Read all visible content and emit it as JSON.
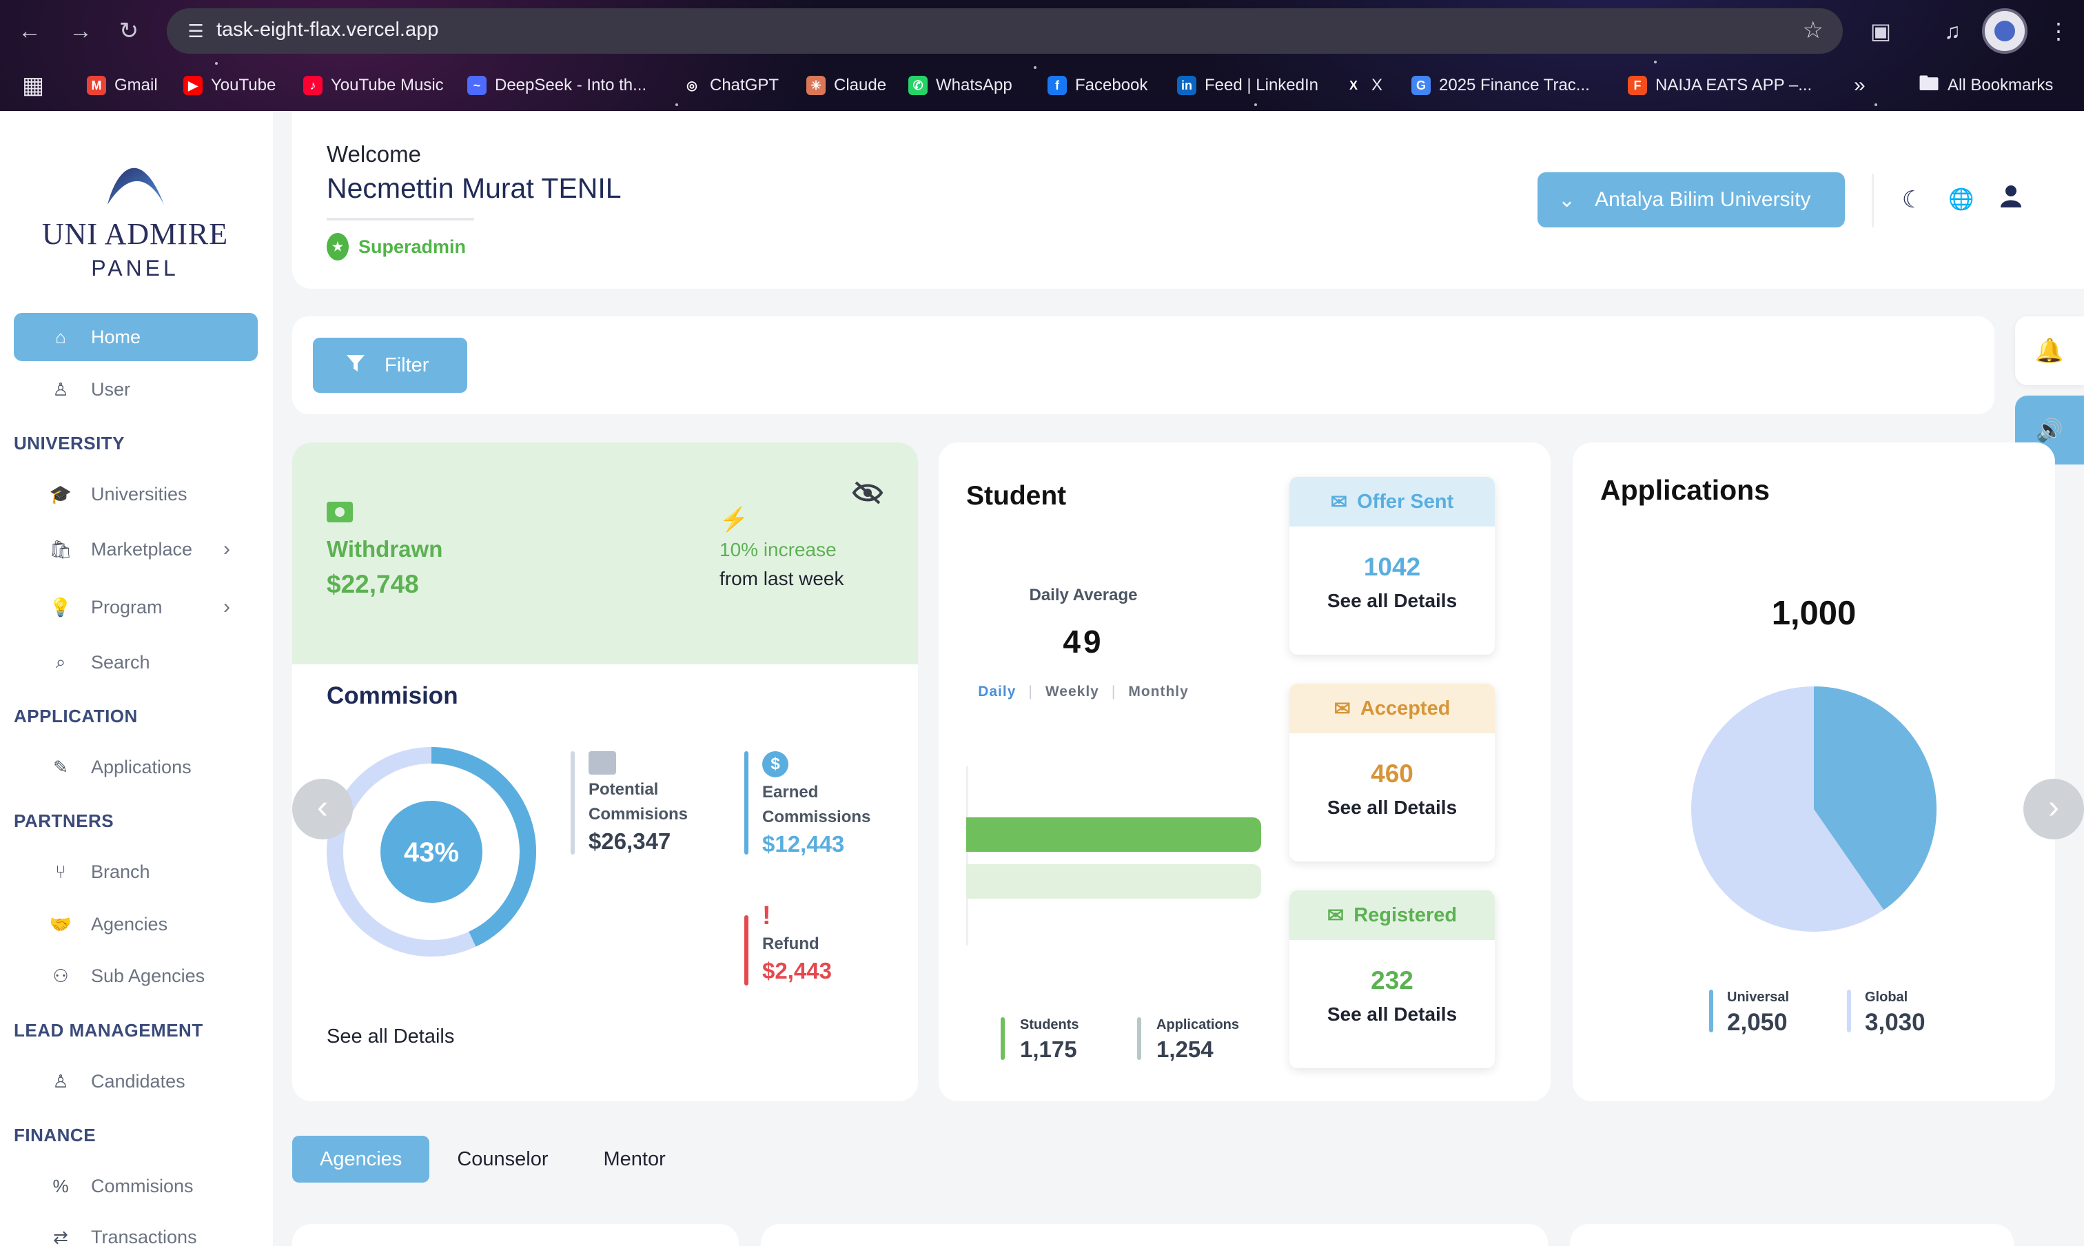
{
  "browser": {
    "url": "task-eight-flax.vercel.app",
    "bookmarks": [
      {
        "label": "Gmail",
        "icon": "gmail-icon",
        "color": "#ea4335"
      },
      {
        "label": "YouTube",
        "icon": "youtube-icon",
        "color": "#ff0000"
      },
      {
        "label": "YouTube Music",
        "icon": "youtube-music-icon",
        "color": "#ff0033"
      },
      {
        "label": "DeepSeek - Into th...",
        "icon": "deepseek-icon",
        "color": "#4d6bfe"
      },
      {
        "label": "ChatGPT",
        "icon": "chatgpt-icon",
        "color": "#ffffff"
      },
      {
        "label": "Claude",
        "icon": "claude-icon",
        "color": "#d97757"
      },
      {
        "label": "WhatsApp",
        "icon": "whatsapp-icon",
        "color": "#25d366"
      },
      {
        "label": "Facebook",
        "icon": "facebook-icon",
        "color": "#1877f2"
      },
      {
        "label": "Feed | LinkedIn",
        "icon": "linkedin-icon",
        "color": "#0a66c2"
      },
      {
        "label": "X",
        "icon": "x-icon",
        "color": "#000000"
      },
      {
        "label": "2025 Finance Trac...",
        "icon": "google-icon",
        "color": "#4285f4"
      },
      {
        "label": "NAIJA EATS APP –...",
        "icon": "figma-icon",
        "color": "#f24e1e"
      }
    ],
    "all_bookmarks": "All Bookmarks"
  },
  "sidebar": {
    "logo_title": "UNI ADMIRE",
    "logo_subtitle": "PANEL",
    "items_top": [
      {
        "label": "Home",
        "icon": "home-icon"
      },
      {
        "label": "User",
        "icon": "user-icon"
      }
    ],
    "sections": [
      {
        "title": "UNIVERSITY",
        "items": [
          {
            "label": "Universities",
            "icon": "graduation-cap-icon"
          },
          {
            "label": "Marketplace",
            "icon": "shopping-bag-icon"
          },
          {
            "label": "Program",
            "icon": "lightbulb-icon"
          },
          {
            "label": "Search",
            "icon": "search-icon"
          }
        ]
      },
      {
        "title": "APPLICATION",
        "items": [
          {
            "label": "Applications",
            "icon": "edit-document-icon"
          }
        ]
      },
      {
        "title": "PARTNERS",
        "items": [
          {
            "label": "Branch",
            "icon": "git-branch-icon"
          },
          {
            "label": "Agencies",
            "icon": "handshake-icon"
          },
          {
            "label": "Sub Agencies",
            "icon": "org-tree-icon"
          }
        ]
      },
      {
        "title": "LEAD MANAGEMENT",
        "items": [
          {
            "label": "Candidates",
            "icon": "user-icon"
          }
        ]
      },
      {
        "title": "FINANCE",
        "items": [
          {
            "label": "Commisions",
            "icon": "percent-icon"
          },
          {
            "label": "Transactions",
            "icon": "transactions-icon"
          }
        ]
      }
    ]
  },
  "header": {
    "welcome": "Welcome",
    "user_name": "Necmettin Murat TENIL",
    "role": "Superadmin",
    "university_select": "Antalya Bilim University"
  },
  "filter": {
    "label": "Filter"
  },
  "commission": {
    "withdrawn_label": "Withdrawn",
    "withdrawn_value": "$22,748",
    "increase_text": "10% increase",
    "increase_suffix": "from last week",
    "title": "Commision",
    "percent": 43,
    "percent_label": "43%",
    "potential_label_1": "Potential",
    "potential_label_2": "Commisions",
    "potential_value": "$26,347",
    "earned_label_1": "Earned",
    "earned_label_2": "Commissions",
    "earned_value": "$12,443",
    "refund_label": "Refund",
    "refund_value": "$2,443",
    "see_all": "See all Details",
    "colors": {
      "withdrawn": "#5cb152",
      "earned": "#5aaedf",
      "refund": "#e5484d"
    }
  },
  "student": {
    "title": "Student",
    "daily_average_label": "Daily Average",
    "daily_average_value": "49",
    "periods": [
      "Daily",
      "Weekly",
      "Monthly"
    ],
    "active_period": "Daily",
    "students_label": "Students",
    "students_value": "1,175",
    "applications_label": "Applications",
    "applications_value": "1,254",
    "status_cards": [
      {
        "title": "Offer Sent",
        "value": "1042",
        "link": "See all Details",
        "icon": "envelope-icon",
        "color": "#5aaedf",
        "bg": "#dbeef8"
      },
      {
        "title": "Accepted",
        "value": "460",
        "link": "See all Details",
        "icon": "envelope-icon",
        "color": "#d6953a",
        "bg": "#fbefd9"
      },
      {
        "title": "Registered",
        "value": "232",
        "link": "See all Details",
        "icon": "envelope-icon",
        "color": "#5cb152",
        "bg": "#e2f2e1"
      }
    ]
  },
  "applications": {
    "title": "Applications",
    "total": "1,000",
    "universal_label": "Universal",
    "universal_value": "2,050",
    "global_label": "Global",
    "global_value": "3,030"
  },
  "tabs": [
    "Agencies",
    "Counselor",
    "Mentor"
  ],
  "active_tab": "Agencies"
}
